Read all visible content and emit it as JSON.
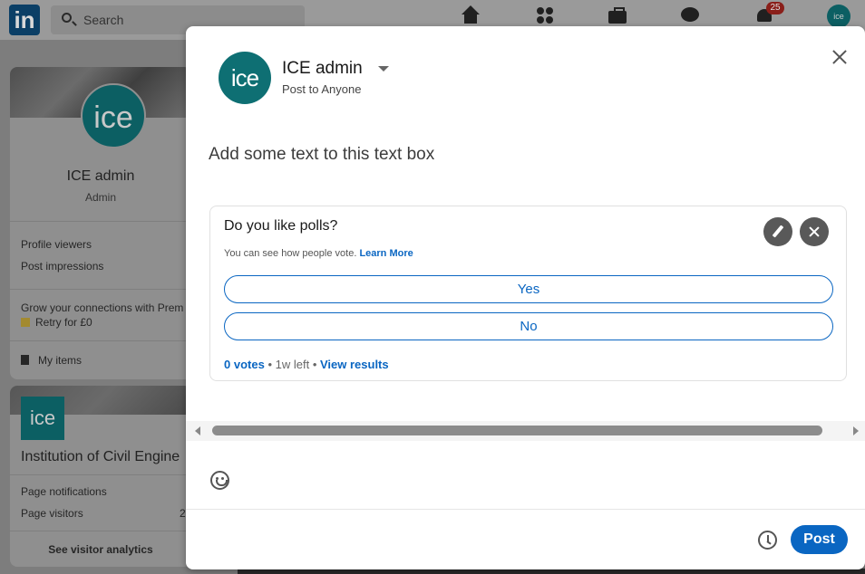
{
  "background": {
    "logo": "in",
    "search_placeholder": "Search",
    "notifications_badge": "25",
    "me_avatar_text": "ice",
    "profile": {
      "avatar_text": "ice",
      "name": "ICE admin",
      "role": "Admin",
      "stats": [
        "Profile viewers",
        "Post impressions"
      ],
      "premium_text": "Grow your connections with Prem",
      "retry_text": "Retry for £0",
      "my_items": "My items"
    },
    "page": {
      "logo_text": "ice",
      "name": "Institution of Civil Engine",
      "stats": [
        "Page notifications",
        "Page visitors"
      ],
      "visitors_count": "2",
      "analytics_link": "See visitor analytics"
    }
  },
  "modal": {
    "avatar_text": "ice",
    "author": "ICE admin",
    "visibility": "Post to Anyone",
    "post_text": "Add some text to this text box",
    "poll": {
      "question": "Do you like polls?",
      "subtext": "You can see how people vote.",
      "learn_more": "Learn More",
      "options": [
        "Yes",
        "No"
      ],
      "votes": "0 votes",
      "time_left": "1w left",
      "view_results": "View results"
    },
    "post_button": "Post",
    "icons": [
      "close-icon",
      "pencil-icon",
      "x-icon",
      "emoji-icon",
      "clock-icon",
      "caret-down-icon"
    ],
    "colors": {
      "accent": "#0a66c2",
      "avatar": "#0e6f73"
    }
  }
}
